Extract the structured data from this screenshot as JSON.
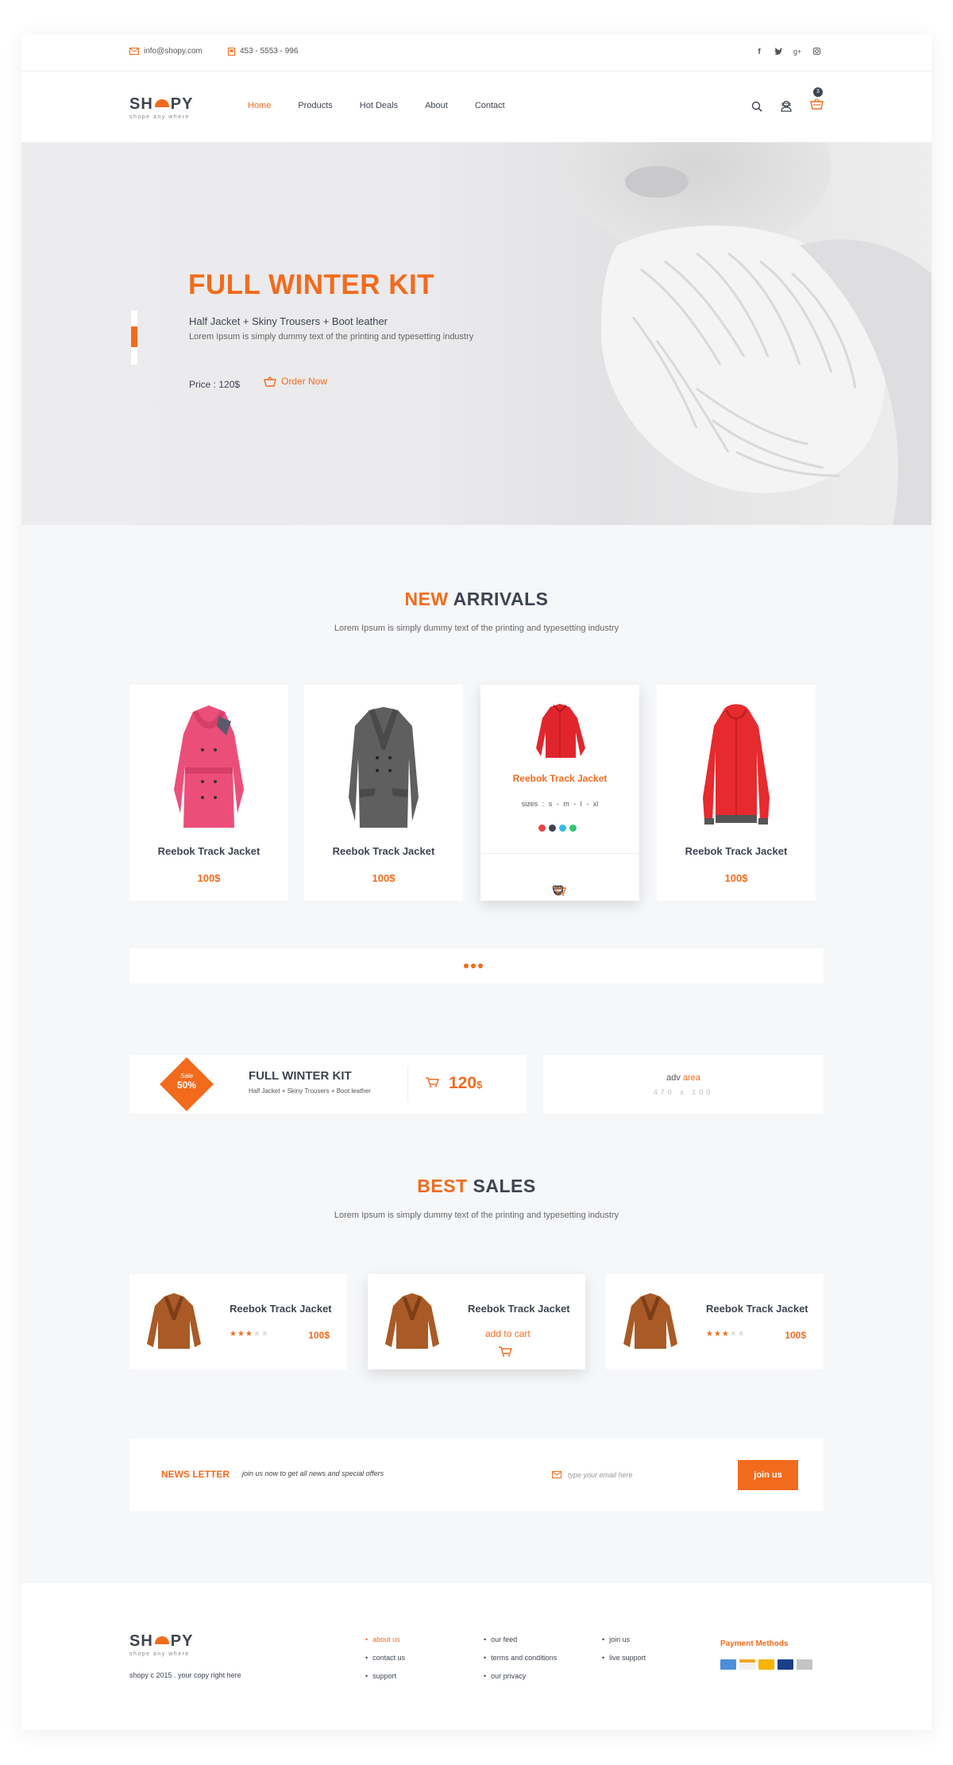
{
  "topbar": {
    "email": "info@shopy.com",
    "phone": "453 - 5553 - 996",
    "social": [
      "f",
      "t",
      "g+",
      "ig"
    ]
  },
  "header": {
    "logo_left": "SH",
    "logo_right": "PY",
    "tagline": "shope any where",
    "nav": [
      "Home",
      "Products",
      "Hot Deals",
      "About",
      "Contact"
    ],
    "cart_count": "3"
  },
  "hero": {
    "title": "FULL WINTER KIT",
    "subtitle": "Half Jacket + Skiny Trousers + Boot leather",
    "description": "Lorem Ipsum is simply dummy text of the printing and typesetting industry",
    "price": "Price : 120$",
    "order_label": "Order Now"
  },
  "new_arrivals": {
    "title_accent": "NEW",
    "title_rest": "ARRIVALS",
    "subtitle": "Lorem Ipsum is simply dummy text of the printing and typesetting industry",
    "products": [
      {
        "name": "Reebok Track Jacket",
        "price": "100$"
      },
      {
        "name": "Reebok Track Jacket",
        "price": "100$"
      },
      {
        "name": "Reebok Track Jacket",
        "sizes": "sizes   :   s - m - l - xl",
        "colors": [
          "#e84548",
          "#3d4450",
          "#35b9e9",
          "#32c47a"
        ]
      },
      {
        "name": "Reebok Track Jacket",
        "price": "100$"
      }
    ]
  },
  "promo": {
    "badge_top": "Sale",
    "badge_bottom": "50%",
    "title": "FULL WINTER KIT",
    "subtitle": "Half Jacket + Skiny Trousers + Boot leather",
    "price": "120",
    "currency": "$"
  },
  "adv": {
    "word1": "adv",
    "word2": "area",
    "size": "470 x 100"
  },
  "best_sales": {
    "title_accent": "BEST",
    "title_rest": "SALES",
    "subtitle": "Lorem Ipsum is simply dummy text of the printing and typesetting industry",
    "products": [
      {
        "name": "Reebok Track Jacket",
        "rating": 3,
        "max": 5,
        "price": "100$"
      },
      {
        "name": "Reebok Track Jacket",
        "add_label": "add to cart"
      },
      {
        "name": "Reebok Track Jacket",
        "rating": 3,
        "max": 5,
        "price": "100$"
      }
    ]
  },
  "newsletter": {
    "title": "NEWS LETTER",
    "subtitle": "join us now to get all news and special offers",
    "placeholder": "type your email here",
    "button": "join us"
  },
  "footer": {
    "copyright": "shopy c 2015 . your copy right here",
    "col1": [
      "about us",
      "contact us",
      "support"
    ],
    "col2": [
      "our feed",
      "terms and conditions",
      "our privacy"
    ],
    "col3": [
      "join us",
      "live support"
    ],
    "payment_title": "Payment Methods",
    "payment_colors": [
      "#4a90d9",
      "#f5a623",
      "#f7b500",
      "#d0021b",
      "#9b9b9b"
    ]
  },
  "colors": {
    "accent": "#f26b1d",
    "dark": "#3d4450",
    "background": "#f6f7f9"
  }
}
